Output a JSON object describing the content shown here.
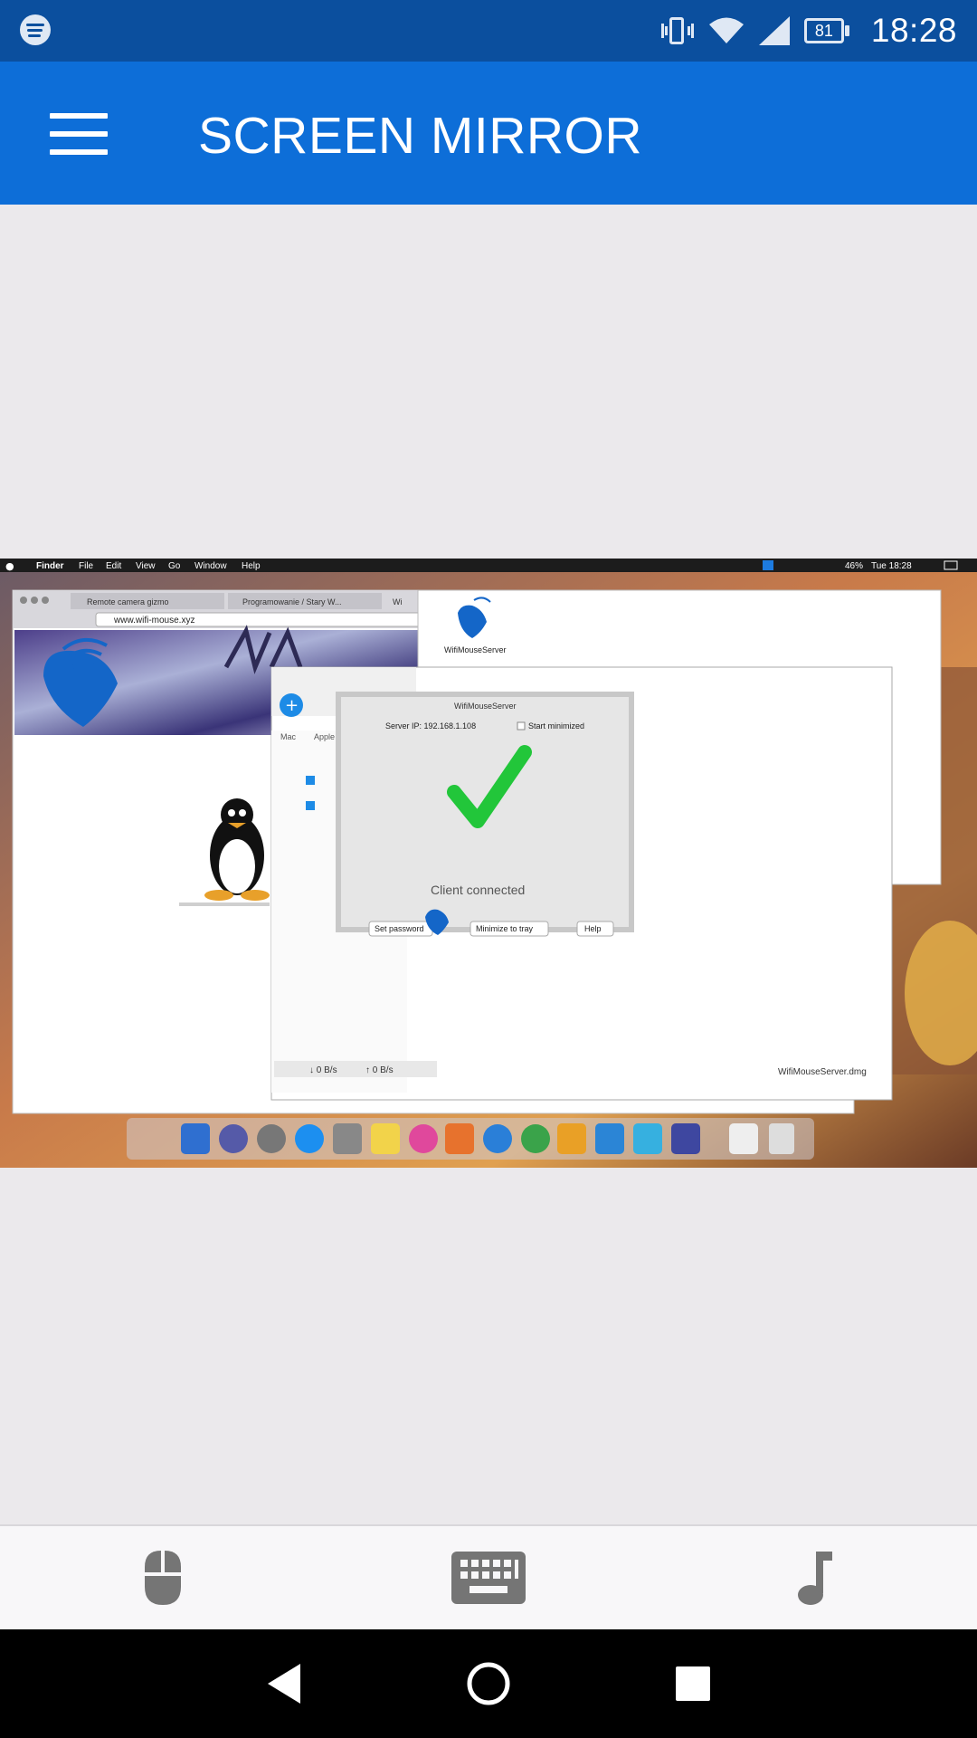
{
  "status_bar": {
    "notification_icons": [
      "spotify-icon"
    ],
    "system_icons": [
      "vibrate-icon",
      "wifi-icon",
      "cell-signal-icon",
      "battery-icon"
    ],
    "battery_level": "81",
    "time": "18:28"
  },
  "app_bar": {
    "menu_icon": "menu-icon",
    "title": "SCREEN MIRROR"
  },
  "mirror": {
    "menubar": {
      "items": [
        "Finder",
        "File",
        "Edit",
        "View",
        "Go",
        "Window",
        "Help"
      ],
      "battery": "46%",
      "clock": "Tue 18:28"
    },
    "browser": {
      "tabs": [
        "Remote camera gizmo",
        "Programowanie / Stary W...",
        "Wi"
      ],
      "url": "www.wifi-mouse.xyz"
    },
    "desktop_icon_label": "WifiMouseServer",
    "server_dialog": {
      "title": "WifiMouseServer",
      "server_ip": "Server IP: 192.168.1.108",
      "start_minimized": "Start minimized",
      "status": "Client connected",
      "buttons": [
        "Set password",
        "Minimize to tray",
        "Help"
      ]
    },
    "finder": {
      "tabs": [
        "Mac",
        "Apple"
      ],
      "down_speed": "↓ 0 B/s",
      "up_speed": "↑ 0 B/s",
      "download_name": "WifiMouseServer.dmg"
    },
    "colors": {
      "check": "#22c63a",
      "mouse_logo": "#1466c8"
    }
  },
  "bottom_nav": {
    "items": [
      {
        "icon": "mouse-icon",
        "label": "mouse"
      },
      {
        "icon": "keyboard-icon",
        "label": "keyboard"
      },
      {
        "icon": "music-note-icon",
        "label": "media"
      }
    ]
  },
  "system_nav": {
    "back": "back-icon",
    "home": "home-icon",
    "recents": "recents-icon"
  },
  "colors": {
    "status_bar": "#0b4f9e",
    "app_bar": "#0d6ed8",
    "background": "#ebe9ec",
    "nav_icon": "#757575"
  }
}
